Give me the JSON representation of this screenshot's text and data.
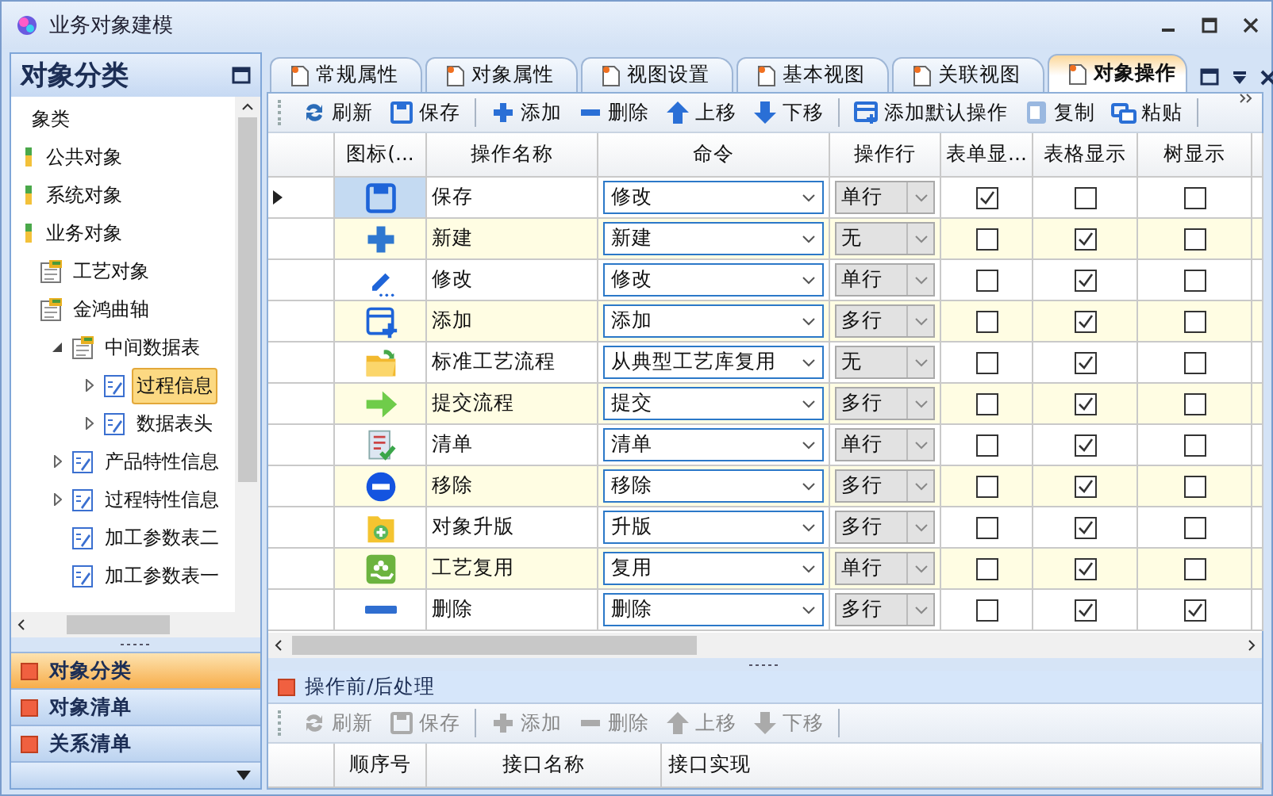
{
  "window": {
    "title": "业务对象建模"
  },
  "left_panel": {
    "title": "对象分类",
    "tree": [
      {
        "label": "象类",
        "children": [
          {
            "label": "公共对象"
          },
          {
            "label": "系统对象"
          },
          {
            "label": "业务对象",
            "children": [
              {
                "label": "工艺对象"
              },
              {
                "label": "金鸿曲轴",
                "children": [
                  {
                    "label": "中间数据表",
                    "expanded": true,
                    "selected": false,
                    "children": [
                      {
                        "label": "过程信息",
                        "expanded": false,
                        "selected": true
                      },
                      {
                        "label": "数据表头",
                        "expanded": false,
                        "selected": false
                      }
                    ]
                  },
                  {
                    "label": "产品特性信息",
                    "expanded": false,
                    "selected": false
                  },
                  {
                    "label": "过程特性信息",
                    "expanded": false,
                    "selected": false
                  },
                  {
                    "label": "加工参数表二",
                    "selected": false
                  },
                  {
                    "label": "加工参数表一",
                    "selected": false
                  }
                ]
              }
            ]
          }
        ]
      }
    ],
    "nav": [
      {
        "label": "对象分类",
        "selected": true
      },
      {
        "label": "对象清单",
        "selected": false
      },
      {
        "label": "关系清单",
        "selected": false
      }
    ]
  },
  "tabs": [
    {
      "label": "常规属性",
      "selected": false
    },
    {
      "label": "对象属性",
      "selected": false
    },
    {
      "label": "视图设置",
      "selected": false
    },
    {
      "label": "基本视图",
      "selected": false
    },
    {
      "label": "关联视图",
      "selected": false
    },
    {
      "label": "对象操作",
      "selected": true
    }
  ],
  "toolbar": {
    "disabled": false,
    "groups": [
      [
        "刷新",
        "保存"
      ],
      [
        "添加",
        "删除",
        "上移",
        "下移"
      ],
      [
        "添加默认操作",
        "复制",
        "粘贴"
      ]
    ]
  },
  "table": {
    "columns": [
      "图标(...",
      "操作名称",
      "命令",
      "操作行",
      "表单显...",
      "表格显示",
      "树显示"
    ],
    "rows": [
      {
        "name": "保存",
        "command": "修改",
        "row_mode": "单行",
        "form_display": true,
        "grid_display": false,
        "tree_display": false,
        "selected": true
      },
      {
        "name": "新建",
        "command": "新建",
        "row_mode": "无",
        "form_display": false,
        "grid_display": true,
        "tree_display": false,
        "selected": false
      },
      {
        "name": "修改",
        "command": "修改",
        "row_mode": "单行",
        "form_display": false,
        "grid_display": true,
        "tree_display": false,
        "selected": false
      },
      {
        "name": "添加",
        "command": "添加",
        "row_mode": "多行",
        "form_display": false,
        "grid_display": true,
        "tree_display": false,
        "selected": false
      },
      {
        "name": "标准工艺流程",
        "command": "从典型工艺库复用",
        "row_mode": "无",
        "form_display": false,
        "grid_display": true,
        "tree_display": false,
        "selected": false
      },
      {
        "name": "提交流程",
        "command": "提交",
        "row_mode": "多行",
        "form_display": false,
        "grid_display": true,
        "tree_display": false,
        "selected": false
      },
      {
        "name": "清单",
        "command": "清单",
        "row_mode": "单行",
        "form_display": false,
        "grid_display": true,
        "tree_display": false,
        "selected": false
      },
      {
        "name": "移除",
        "command": "移除",
        "row_mode": "多行",
        "form_display": false,
        "grid_display": true,
        "tree_display": false,
        "selected": false
      },
      {
        "name": "对象升版",
        "command": "升版",
        "row_mode": "多行",
        "form_display": false,
        "grid_display": true,
        "tree_display": false,
        "selected": false
      },
      {
        "name": "工艺复用",
        "command": "复用",
        "row_mode": "单行",
        "form_display": false,
        "grid_display": true,
        "tree_display": false,
        "selected": false
      },
      {
        "name": "删除",
        "command": "删除",
        "row_mode": "多行",
        "form_display": false,
        "grid_display": true,
        "tree_display": true,
        "selected": false
      }
    ]
  },
  "bottom_panel": {
    "title": "操作前/后处理",
    "toolbar": {
      "disabled": true,
      "groups": [
        [
          "刷新",
          "保存"
        ],
        [
          "添加",
          "删除",
          "上移",
          "下移"
        ]
      ]
    },
    "columns": [
      "顺序号",
      "接口名称",
      "接口实现"
    ]
  }
}
